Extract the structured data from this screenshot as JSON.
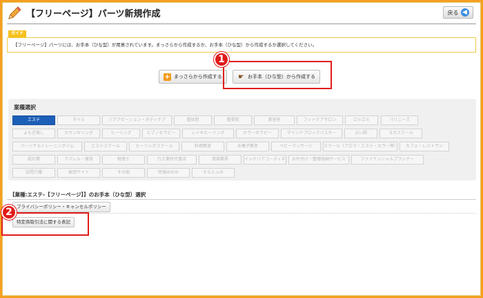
{
  "header": {
    "title": "【フリーページ】パーツ新規作成",
    "back_label": "戻る",
    "back_icon": "arrow-left-icon",
    "title_icon": "pencil-icon"
  },
  "guide": {
    "tag": "ガイド",
    "text": "【フリーページ】パーツには、お手本（ひな型）が用意されています。まっさらから作成するか、お手本（ひな型）から作成するか選択してください。"
  },
  "create": {
    "blank_label": "まっさらから作成する",
    "template_label": "お手本（ひな型）から作成する"
  },
  "annotations": {
    "badge1": "1",
    "badge2": "2",
    "accent": "#e01b1b"
  },
  "industry": {
    "label": "業種選択",
    "active_color": "#1d5fb8",
    "items": [
      "エステ",
      "ネイル",
      "リラクゼーション・ボディケア",
      "整体院",
      "整骨院",
      "美容室",
      "フットケアサロン",
      "ロミロミ",
      "パリニーズ",
      "よもぎ蒸し",
      "カウンセリング",
      "ヒーリング",
      "ヒプノセラピー",
      "レイキヒーリング",
      "カラーセラピー",
      "マインドブロックバスター",
      "占い師",
      "ヨガスクール",
      "パーソナルトレーニングジム",
      "エステスクール",
      "ヒーリングスクール",
      "料理教室",
      "お菓子教室",
      "ベビーマッサージ",
      "スクール（アロマ・エステ・カラー等）",
      "カフェ・レストラン",
      "設計業",
      "アパレル・雑貨",
      "税理士",
      "乃士業所代書店",
      "清掃業界",
      "インテリアコーディネーター",
      "お片付け・整理収納サービス",
      "ファイナンシャルプランナー",
      "訪問介護",
      "採用サイト",
      "その他",
      "特価みのみ",
      "そらとふみ"
    ]
  },
  "templates": {
    "title": "【業種:エステ-【フリーページ】】のお手本（ひな型）選択",
    "items": [
      "プライバシーポリシー・キャンセルポリシー",
      "特定商取引法に関する表記"
    ]
  }
}
